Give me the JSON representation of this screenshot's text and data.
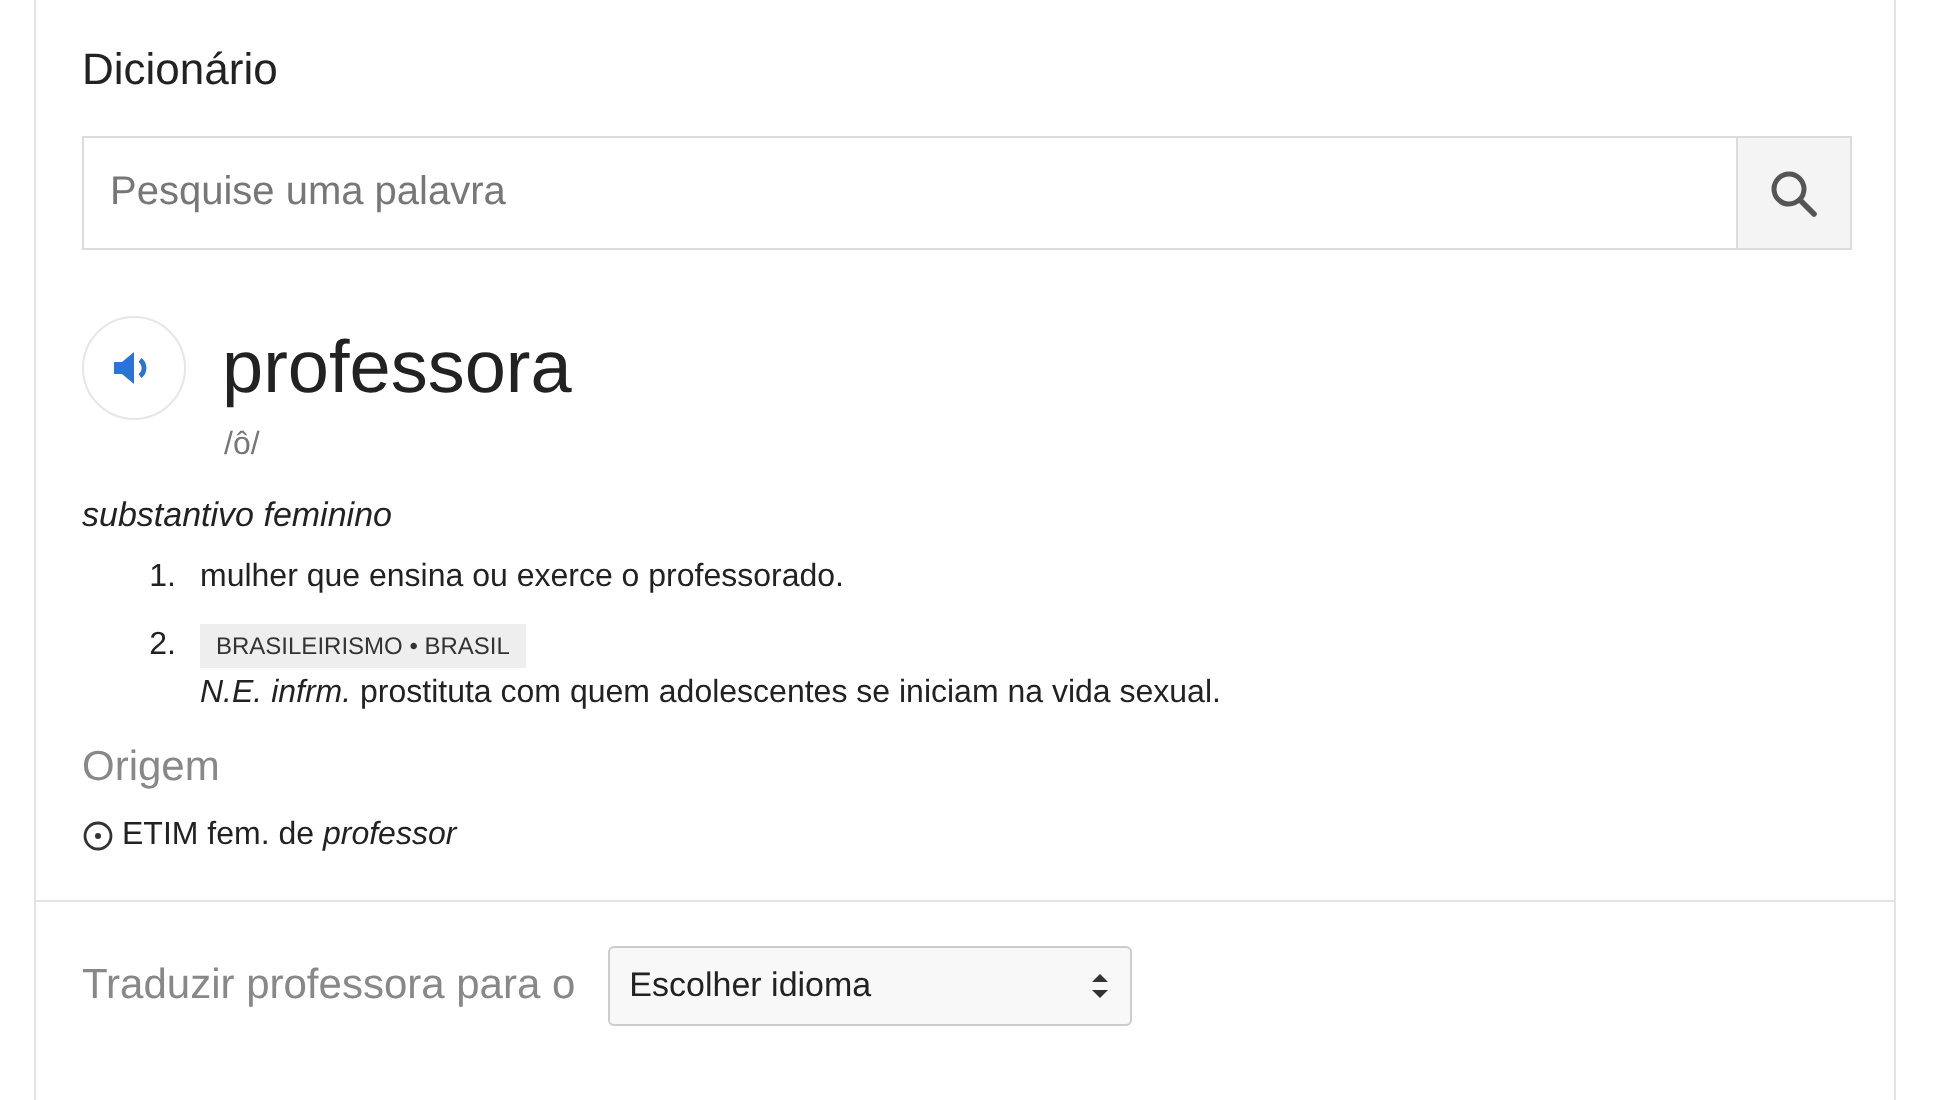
{
  "title": "Dicionário",
  "search": {
    "placeholder": "Pesquise uma palavra"
  },
  "entry": {
    "word": "professora",
    "pronunciation": "/ô/",
    "part_of_speech": "substantivo feminino",
    "definitions": [
      {
        "number": "1.",
        "text": "mulher que ensina ou exerce o professorado."
      },
      {
        "number": "2.",
        "label": "BRASILEIRISMO • BRASIL",
        "text": "*N.E. infrm.* prostituta com quem adolescentes se iniciam na vida sexual."
      }
    ]
  },
  "origin": {
    "heading": "Origem",
    "text": "ETIM fem. de *professor*"
  },
  "translate": {
    "label": "Traduzir professora para o",
    "select_value": "Escolher idioma"
  }
}
